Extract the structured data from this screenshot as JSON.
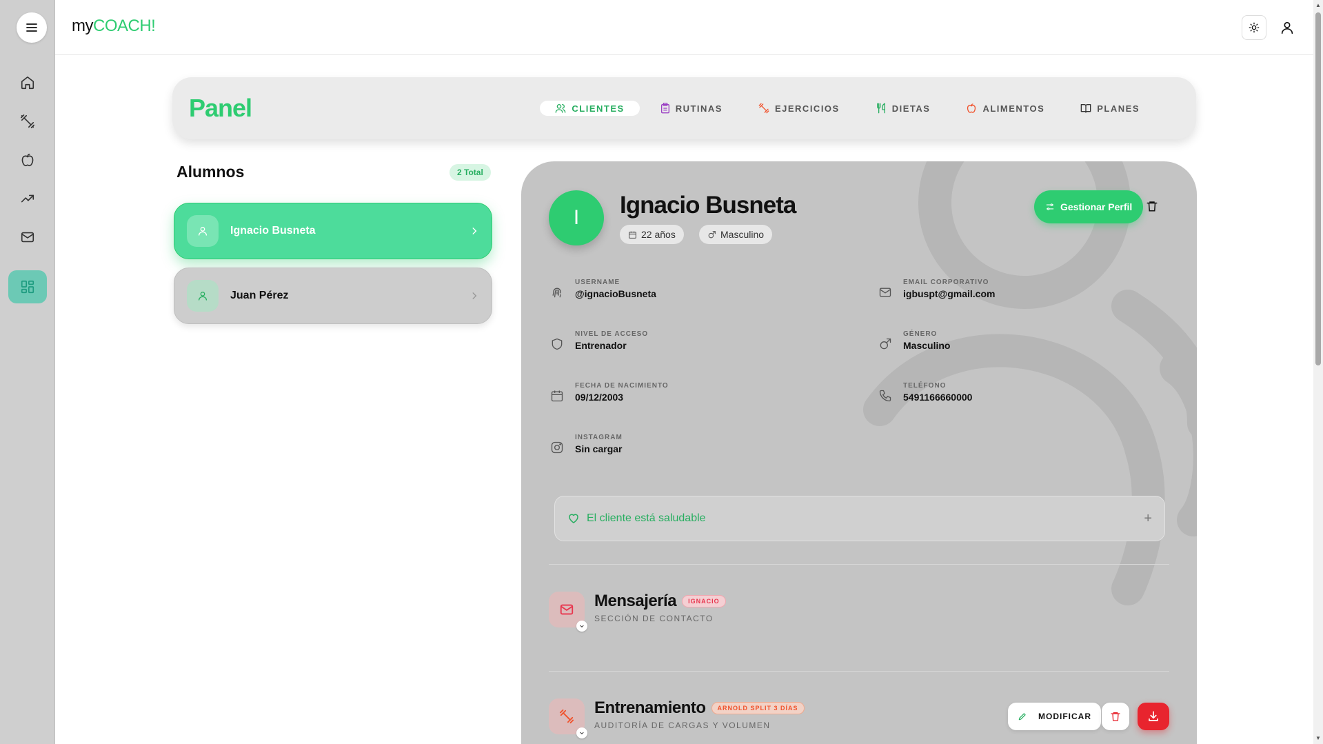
{
  "app": {
    "logo_prefix": "my",
    "logo_brand": "COACH!",
    "brand_color": "#2ecc71"
  },
  "sidebar": {
    "items": [
      {
        "icon": "home-icon"
      },
      {
        "icon": "dumbbell-icon"
      },
      {
        "icon": "apple-icon"
      },
      {
        "icon": "trending-up-icon"
      },
      {
        "icon": "mail-icon"
      },
      {
        "icon": "dashboard-icon",
        "active": true
      }
    ]
  },
  "header": {
    "theme_icon": "sun-icon",
    "user_icon": "user-icon"
  },
  "panel": {
    "title": "Panel",
    "tabs": [
      {
        "label": "CLIENTES",
        "icon": "users-icon",
        "active": true
      },
      {
        "label": "RUTINAS",
        "icon": "clipboard-icon"
      },
      {
        "label": "EJERCICIOS",
        "icon": "dumbbell-icon"
      },
      {
        "label": "DIETAS",
        "icon": "utensils-icon"
      },
      {
        "label": "ALIMENTOS",
        "icon": "apple-icon"
      },
      {
        "label": "PLANES",
        "icon": "book-icon"
      }
    ]
  },
  "students": {
    "title": "Alumnos",
    "total": "2 Total",
    "list": [
      {
        "name": "Ignacio Busneta",
        "active": true
      },
      {
        "name": "Juan Pérez",
        "active": false
      }
    ]
  },
  "profile": {
    "initial": "I",
    "name": "Ignacio Busneta",
    "age": "22 años",
    "gender": "Masculino",
    "manage_label": "Gestionar Perfil",
    "fields": {
      "username": {
        "label": "USERNAME",
        "value": "@ignacioBusneta"
      },
      "email": {
        "label": "EMAIL CORPORATIVO",
        "value": "igbuspt@gmail.com"
      },
      "access": {
        "label": "NIVEL DE ACCESO",
        "value": "Entrenador"
      },
      "gender": {
        "label": "GÉNERO",
        "value": "Masculino"
      },
      "birth": {
        "label": "FECHA DE NACIMIENTO",
        "value": "09/12/2003"
      },
      "phone": {
        "label": "TELÉFONO",
        "value": "5491166660000"
      },
      "instagram": {
        "label": "INSTAGRAM",
        "value": "Sin cargar"
      }
    },
    "health_text": "El cliente está saludable",
    "health_plus": "+"
  },
  "sections": {
    "messaging": {
      "title": "Mensajería",
      "badge": "IGNACIO",
      "subtitle": "SECCIÓN DE CONTACTO",
      "color": "#e8364e"
    },
    "training": {
      "title": "Entrenamiento",
      "badge": "ARNOLD SPLIT 3 DÍAS",
      "subtitle": "AUDITORÍA DE CARGAS Y VOLUMEN",
      "color": "#f0522c",
      "modify_label": "MODIFICAR"
    }
  }
}
